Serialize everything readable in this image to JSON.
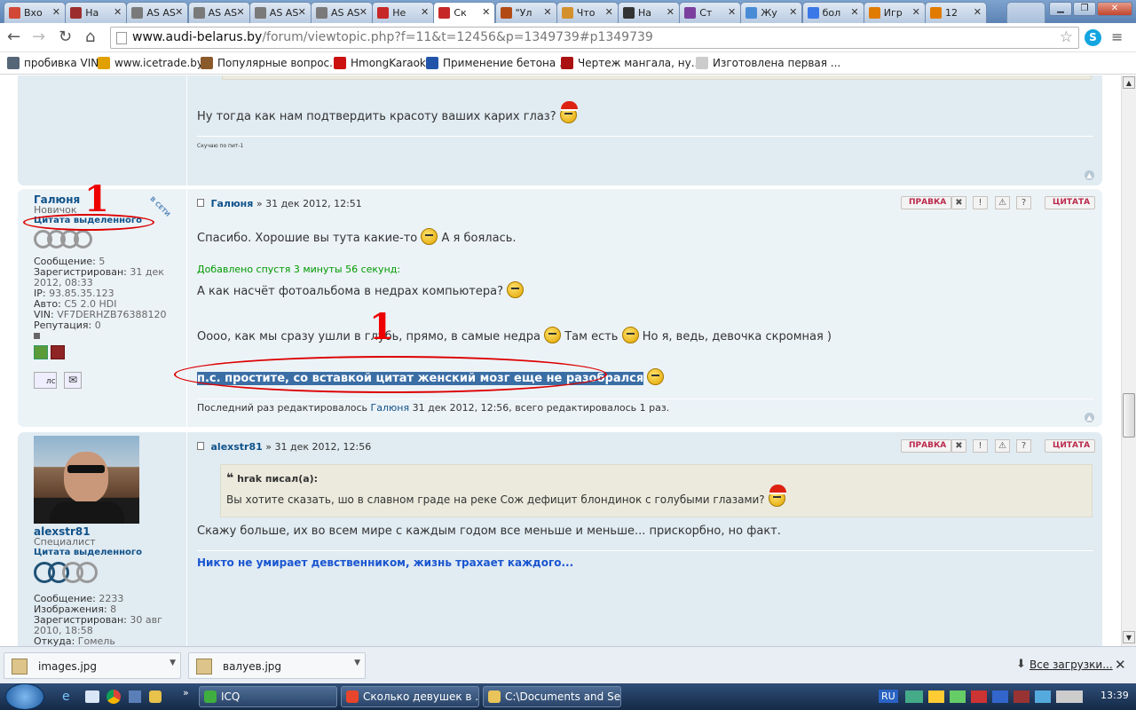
{
  "browser": {
    "tabs": [
      {
        "label": "Вхо",
        "color": "#d14836"
      },
      {
        "label": "На",
        "color": "#9c2e2e"
      },
      {
        "label": "AS AS",
        "color": "#7a7a7a"
      },
      {
        "label": "AS AS",
        "color": "#7a7a7a"
      },
      {
        "label": "AS AS",
        "color": "#7a7a7a"
      },
      {
        "label": "AS AS",
        "color": "#7a7a7a"
      },
      {
        "label": "Не",
        "color": "#c62828"
      },
      {
        "label": "Ск",
        "color": "#c62828"
      },
      {
        "label": "\"Ул",
        "color": "#b24a14"
      },
      {
        "label": "Что",
        "color": "#d4902a"
      },
      {
        "label": "На",
        "color": "#333333"
      },
      {
        "label": "Ст",
        "color": "#7b3f9e"
      },
      {
        "label": "Жу",
        "color": "#4a8bd6"
      },
      {
        "label": "бол",
        "color": "#3b78e7"
      },
      {
        "label": "Игр",
        "color": "#e07b00"
      },
      {
        "label": "12",
        "color": "#e07b00"
      }
    ],
    "active_tab_index": 7,
    "url_host": "www.audi-belarus.by",
    "url_path": "/forum/viewtopic.php?f=11&t=12456&p=1349739#p1349739",
    "bookmarks": [
      {
        "label": "пробивка VIN",
        "color": "#556677"
      },
      {
        "label": "www.icetrade.by",
        "color": "#e0a000"
      },
      {
        "label": "Популярные вопрос...",
        "color": "#8a5a2a"
      },
      {
        "label": "HmongKaraoke",
        "color": "#cc1111"
      },
      {
        "label": "Применение бетона ...",
        "color": "#2255aa"
      },
      {
        "label": "Чертеж мангала, ну...",
        "color": "#aa1111"
      },
      {
        "label": "Изготовлена первая ...",
        "color": "#cccccc"
      }
    ]
  },
  "forum": {
    "prev_post": {
      "text": "Ну тогда как нам подтвердить красоту ваших карих глаз?",
      "signature": "Скучаю по пит-1"
    },
    "post1": {
      "author": "Галюня",
      "rank": "Новичок",
      "group": "Цитата выделенного",
      "online_badge": "В СЕТИ",
      "stats": [
        {
          "k": "Сообщение:",
          "v": "5"
        },
        {
          "k": "Зарегистрирован:",
          "v": "31 дек 2012, 08:33"
        },
        {
          "k": "IP:",
          "v": "93.85.35.123"
        },
        {
          "k": "Авто:",
          "v": "C5 2.0 HDI"
        },
        {
          "k": "VIN:",
          "v": "VF7DERHZB76388120"
        },
        {
          "k": "Репутация:",
          "v": "0"
        }
      ],
      "pm_label": "лс",
      "date_line": "» 31 дек 2012, 12:51",
      "line1_a": "Спасибо. Хорошие вы тута какие-то",
      "line1_b": "А я боялась.",
      "added": "Добавлено спустя 3 минуты 56 секунд:",
      "line2": "А как насчёт фотоальбома в недрах компьютера?",
      "line3_a": "Оооо, как мы сразу ушли в глубь, прямо, в самые недра",
      "line3_b": "Там есть",
      "line3_c": "Но я, ведь, девочка скромная )",
      "selected": "п.с. простите, со вставкой цитат женский мозг еще не разобрался",
      "edited_a": "Последний раз редактировалось",
      "edited_user": "Галюня",
      "edited_b": "31 дек 2012, 12:56, всего редактировалось 1 раз."
    },
    "post2": {
      "author": "alexstr81",
      "rank": "Специалист",
      "group": "Цитата выделенного",
      "stats": [
        {
          "k": "Сообщение:",
          "v": "2233"
        },
        {
          "k": "Изображения:",
          "v": "8"
        },
        {
          "k": "Зарегистрирован:",
          "v": "30 авг 2010, 18:58"
        },
        {
          "k": "Откуда:",
          "v": "Гомель"
        }
      ],
      "date_line": "» 31 дек 2012, 12:56",
      "quote_author": "hrak писал(а):",
      "quote_text": "Вы хотите сказать, шо в славном граде на реке Сож дефицит блондинок с голубыми глазами?",
      "reply": "Скажу больше, их во всем мире с каждым годом все меньше и меньше... прискорбно, но факт.",
      "signature": "Никто не умирает девственником, жизнь трахает каждого..."
    },
    "edit_btn": "ПРАВКА",
    "quote_btn": "ЦИТАТА",
    "annotation_mark": "1"
  },
  "downloads": {
    "items": [
      "images.jpg",
      "валуев.jpg"
    ],
    "all_label": "Все загрузки..."
  },
  "taskbar": {
    "items": [
      {
        "label": "ICQ",
        "color": "#3fae3f"
      },
      {
        "label": "Сколько девушек в ...",
        "color": "#e8452c"
      },
      {
        "label": "C:\\Documents and Set...",
        "color": "#e8c45a"
      }
    ],
    "lang": "RU",
    "clock": "13:39"
  }
}
